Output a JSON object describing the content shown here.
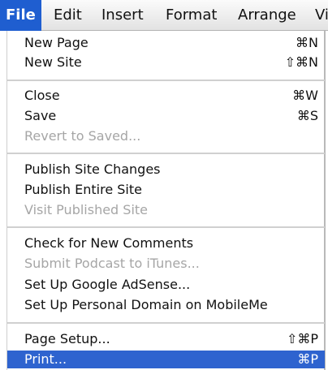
{
  "menubar": {
    "items": [
      {
        "label": "File",
        "active": true
      },
      {
        "label": "Edit"
      },
      {
        "label": "Insert"
      },
      {
        "label": "Format"
      },
      {
        "label": "Arrange"
      },
      {
        "label": "Vi"
      }
    ]
  },
  "menu": {
    "groups": [
      [
        {
          "label": "New Page",
          "shortcut": "⌘N",
          "enabled": true
        },
        {
          "label": "New Site",
          "shortcut": "⇧⌘N",
          "enabled": true
        }
      ],
      [
        {
          "label": "Close",
          "shortcut": "⌘W",
          "enabled": true
        },
        {
          "label": "Save",
          "shortcut": "⌘S",
          "enabled": true
        },
        {
          "label": "Revert to Saved...",
          "shortcut": "",
          "enabled": false
        }
      ],
      [
        {
          "label": "Publish Site Changes",
          "shortcut": "",
          "enabled": true
        },
        {
          "label": "Publish Entire Site",
          "shortcut": "",
          "enabled": true
        },
        {
          "label": "Visit Published Site",
          "shortcut": "",
          "enabled": false
        }
      ],
      [
        {
          "label": "Check for New Comments",
          "shortcut": "",
          "enabled": true
        },
        {
          "label": "Submit Podcast to iTunes...",
          "shortcut": "",
          "enabled": false
        },
        {
          "label": "Set Up Google AdSense...",
          "shortcut": "",
          "enabled": true
        },
        {
          "label": "Set Up Personal Domain on MobileMe",
          "shortcut": "",
          "enabled": true
        }
      ],
      [
        {
          "label": "Page Setup...",
          "shortcut": "⇧⌘P",
          "enabled": true
        },
        {
          "label": "Print...",
          "shortcut": "⌘P",
          "enabled": true,
          "highlighted": true
        }
      ]
    ]
  },
  "colors": {
    "highlight": "#2e63cf",
    "active_menu": "#1f5ed0",
    "disabled_text": "#a6a6a6"
  }
}
